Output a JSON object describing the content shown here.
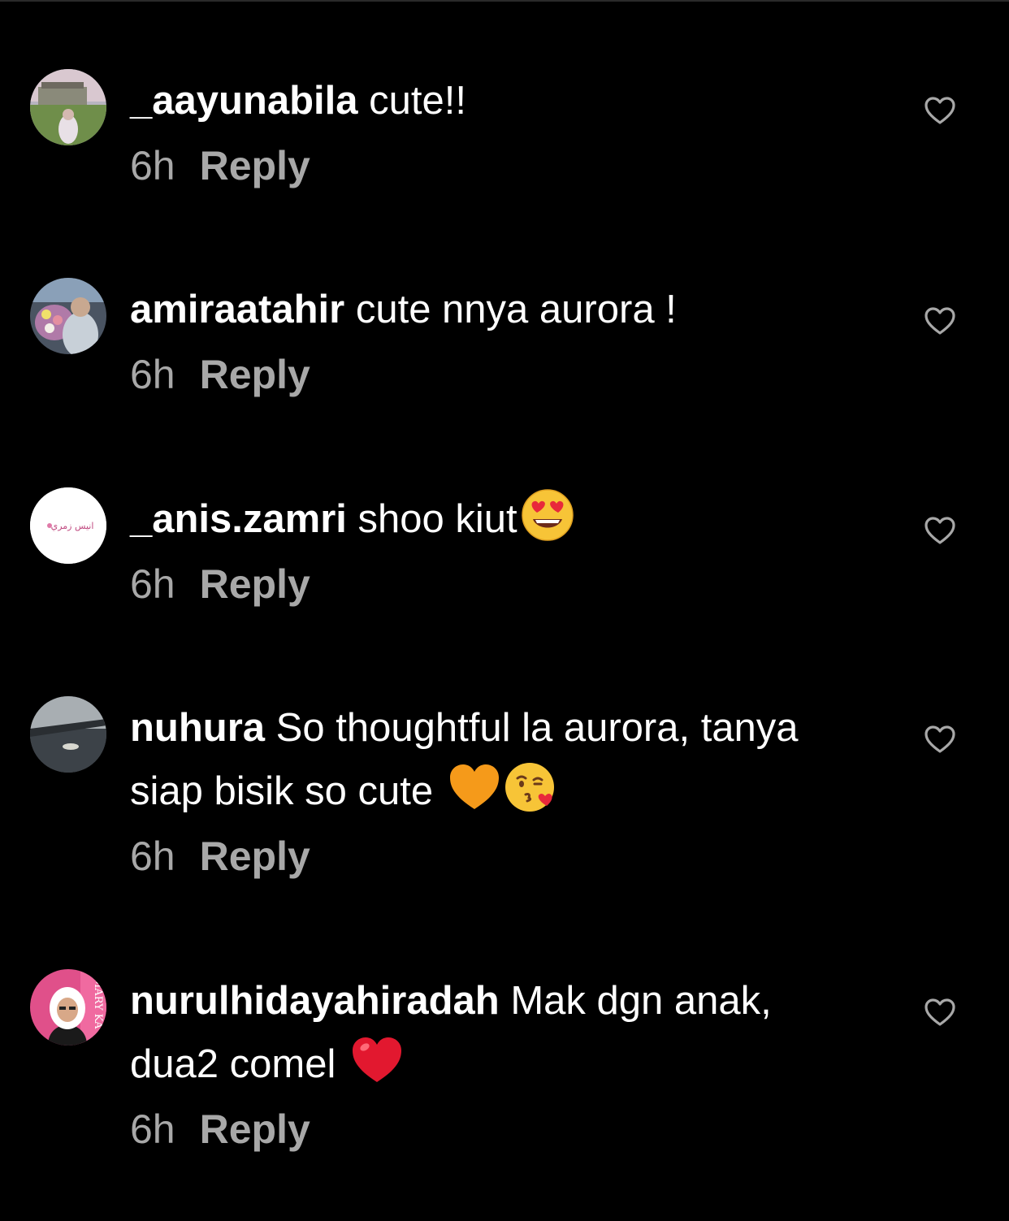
{
  "comments": [
    {
      "username": "_aayunabila",
      "text": "cute!!",
      "emoji": [],
      "time": "6h",
      "reply": "Reply"
    },
    {
      "username": "amiraatahir",
      "text": "cute nnya aurora !",
      "emoji": [],
      "time": "6h",
      "reply": "Reply"
    },
    {
      "username": "_anis.zamri",
      "text": "shoo kiut",
      "emoji": [
        "smiling-face-with-heart-eyes"
      ],
      "time": "6h",
      "reply": "Reply",
      "avatar_text": "انيس زمري"
    },
    {
      "username": "nuhura",
      "text": "So thoughtful la aurora, tanya siap bisik so cute",
      "emoji": [
        "orange-heart",
        "face-blowing-a-kiss"
      ],
      "time": "6h",
      "reply": "Reply"
    },
    {
      "username": "nurulhidayahiradah",
      "text": "Mak dgn anak, dua2 comel",
      "emoji": [
        "red-heart"
      ],
      "time": "6h",
      "reply": "Reply",
      "avatar_text": "MARY KA"
    }
  ],
  "colors": {
    "background": "#000000",
    "text": "#ffffff",
    "meta": "#a8a8a8",
    "heart_outline": "#a8a8a8"
  },
  "icons": {
    "like": "heart-outline-icon"
  }
}
